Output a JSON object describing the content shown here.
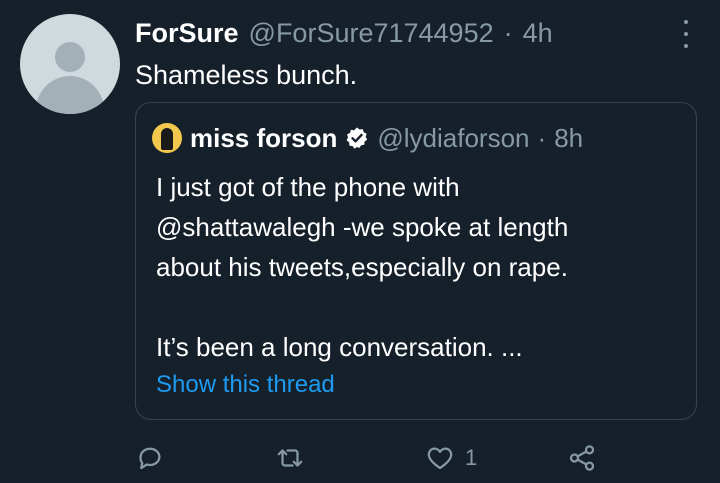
{
  "tweet": {
    "display_name": "ForSure",
    "handle": "@ForSure71744952",
    "separator": "·",
    "time": "4h",
    "text": "Shameless bunch."
  },
  "quoted_tweet": {
    "display_name": "miss forson",
    "handle": "@lydiaforson",
    "separator": "·",
    "time": "8h",
    "lines": [
      "I just got of the phone with",
      "@shattawalegh -we spoke at length",
      "about his tweets,especially on rape."
    ],
    "line2": "It’s been a long conversation. ...",
    "show_thread": "Show this thread"
  },
  "actions": {
    "like_count": "1"
  },
  "colors": {
    "background": "#15202b",
    "secondary_text": "#8899a6",
    "link": "#1d9bf0",
    "border": "#38444d"
  },
  "icons": [
    "avatar-default-icon",
    "more-icon",
    "verified-badge-icon",
    "reply-icon",
    "retweet-icon",
    "like-icon",
    "share-icon"
  ]
}
